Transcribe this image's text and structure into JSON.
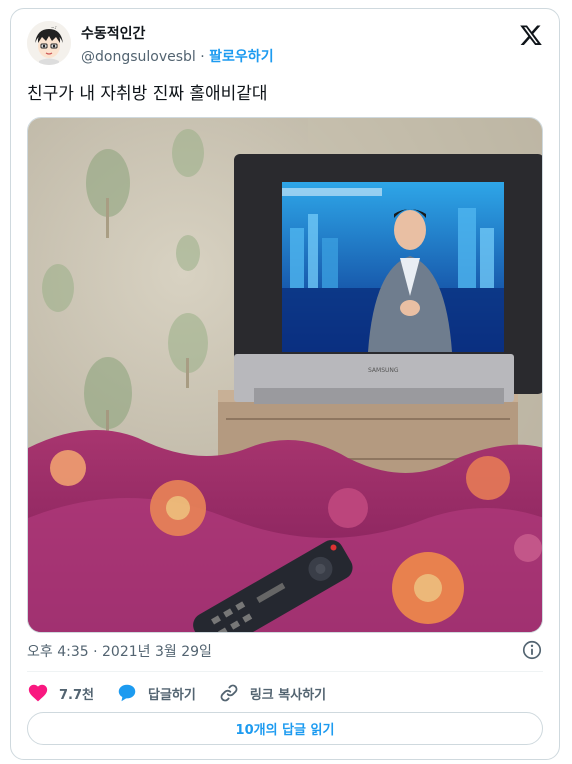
{
  "author": {
    "display_name": "수동적인간",
    "handle": "@dongsulovesbl",
    "separator": "·",
    "follow_label": "팔로우하기",
    "avatar_icon": "cartoon-avatar-icon"
  },
  "platform_icon": "x-logo-icon",
  "tweet": {
    "text": "친구가 내 자취방 진짜 홀애비같대",
    "image_icon": "photo-bedroom-tv"
  },
  "meta": {
    "timestamp": "오후 4:35 · 2021년 3월 29일",
    "info_icon": "info-icon"
  },
  "actions": {
    "like_count": "7.7천",
    "reply_label": "답글하기",
    "copy_link_label": "링크 복사하기"
  },
  "read_replies_label": "10개의 답글 읽기",
  "colors": {
    "accent": "#1d9bf0",
    "like": "#f91880",
    "secondary_text": "#536471",
    "border": "#cfd9de"
  }
}
